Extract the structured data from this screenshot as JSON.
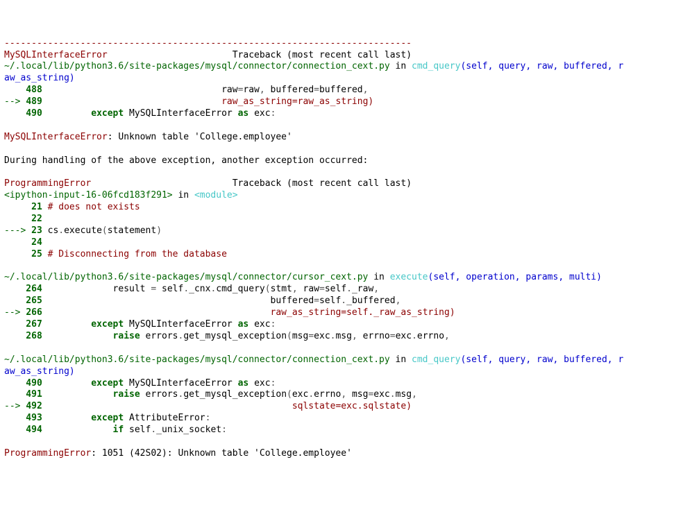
{
  "separator": "---------------------------------------------------------------------------",
  "tb1": {
    "error_name": "MySQLInterfaceError",
    "padding1": "                       ",
    "traceback_text": "Traceback (most recent call last)",
    "path": "~/.local/lib/python3.6/site-packages/mysql/connector/connection_cext.py",
    "in": " in ",
    "func": "cmd_query",
    "sig_open": "(self, query, raw, buffered, r",
    "sig_wrap": "aw_as_string)",
    "lines": {
      "l488_num": "    488 ",
      "l488_code": "                                raw",
      "l488_eq1": "=",
      "l488_code2": "raw",
      "l488_comma": ", ",
      "l488_code3": "buffered",
      "l488_eq2": "=",
      "l488_code4": "buffered",
      "l488_comma2": ",",
      "l489_arrow": "--> ",
      "l489_num": "489 ",
      "l489_sp": "                                ",
      "l489_code": "raw_as_string",
      "l489_eq": "=",
      "l489_code2": "raw_as_string",
      "l489_paren": ")",
      "l490_num": "    490 ",
      "l490_sp": "        ",
      "l490_kw1": "except",
      "l490_sp2": " ",
      "l490_code": "MySQLInterfaceError ",
      "l490_kw2": "as",
      "l490_sp3": " ",
      "l490_code2": "exc",
      "l490_colon": ":"
    },
    "msg_label": "MySQLInterfaceError",
    "msg_text": ": Unknown table 'College.employee'"
  },
  "during": "During handling of the above exception, another exception occurred:",
  "tb2": {
    "error_name": "ProgrammingError",
    "padding1": "                          ",
    "traceback_text": "Traceback (most recent call last)",
    "ipy_src": "<ipython-input-16-06fcd183f291>",
    "in": " in ",
    "module": "<module>",
    "f1": {
      "l21_num": "     21 ",
      "l21_comment": "# does not exists",
      "l22_num": "     22 ",
      "l23_arrow": "---> ",
      "l23_num": "23 ",
      "l23_c1": "cs",
      "l23_dot": ".",
      "l23_c2": "execute",
      "l23_p1": "(",
      "l23_c3": "statement",
      "l23_p2": ")",
      "l24_num": "     24 ",
      "l25_num": "     25 ",
      "l25_comment": "# Disconnecting from the database"
    },
    "f2": {
      "path": "~/.local/lib/python3.6/site-packages/mysql/connector/cursor_cext.py",
      "in": " in ",
      "func": "execute",
      "sig": "(self, operation, params, multi)",
      "l264_num": "    264 ",
      "l264_c": "            result ",
      "l264_eq": "=",
      "l264_c2": " self",
      "l264_dot": ".",
      "l264_c3": "_cnx",
      "l264_dot2": ".",
      "l264_c4": "cmd_query",
      "l264_p1": "(",
      "l264_c5": "stmt",
      "l264_cm1": ", ",
      "l264_c6": "raw",
      "l264_eq2": "=",
      "l264_c7": "self",
      "l264_dot3": ".",
      "l264_c8": "_raw",
      "l264_cm2": ",",
      "l265_num": "    265 ",
      "l265_sp": "                                         ",
      "l265_c1": "buffered",
      "l265_eq": "=",
      "l265_c2": "self",
      "l265_dot": ".",
      "l265_c3": "_buffered",
      "l265_cm": ",",
      "l266_arrow": "--> ",
      "l266_num": "266 ",
      "l266_sp": "                                         ",
      "l266_c1": "raw_as_string",
      "l266_eq": "=",
      "l266_c2": "self",
      "l266_dot": ".",
      "l266_c3": "_raw_as_string",
      "l266_p": ")",
      "l267_num": "    267 ",
      "l267_sp": "        ",
      "l267_kw1": "except",
      "l267_c1": " MySQLInterfaceError ",
      "l267_kw2": "as",
      "l267_c2": " exc",
      "l267_col": ":",
      "l268_num": "    268 ",
      "l268_sp": "            ",
      "l268_kw": "raise",
      "l268_c1": " errors",
      "l268_dot": ".",
      "l268_c2": "get_mysql_exception",
      "l268_p1": "(",
      "l268_c3": "msg",
      "l268_eq1": "=",
      "l268_c4": "exc",
      "l268_dot2": ".",
      "l268_c5": "msg",
      "l268_cm": ", ",
      "l268_c6": "errno",
      "l268_eq2": "=",
      "l268_c7": "exc",
      "l268_dot3": ".",
      "l268_c8": "errno",
      "l268_cm2": ","
    },
    "f3": {
      "path": "~/.local/lib/python3.6/site-packages/mysql/connector/connection_cext.py",
      "in": " in ",
      "func": "cmd_query",
      "sig_open": "(self, query, raw, buffered, r",
      "sig_wrap": "aw_as_string)",
      "l490_num": "    490 ",
      "l490_sp": "        ",
      "l490_kw1": "except",
      "l490_c1": " MySQLInterfaceError ",
      "l490_kw2": "as",
      "l490_c2": " exc",
      "l490_col": ":",
      "l491_num": "    491 ",
      "l491_sp": "            ",
      "l491_kw": "raise",
      "l491_c1": " errors",
      "l491_dot1": ".",
      "l491_c2": "get_mysql_exception",
      "l491_p1": "(",
      "l491_c3": "exc",
      "l491_dot2": ".",
      "l491_c4": "errno",
      "l491_cm": ", ",
      "l491_c5": "msg",
      "l491_eq": "=",
      "l491_c6": "exc",
      "l491_dot3": ".",
      "l491_c7": "msg",
      "l491_cm2": ",",
      "l492_arrow": "--> ",
      "l492_num": "492 ",
      "l492_sp": "                                             ",
      "l492_c1": "sqlstate",
      "l492_eq": "=",
      "l492_c2": "exc",
      "l492_dot": ".",
      "l492_c3": "sqlstate",
      "l492_p": ")",
      "l493_num": "    493 ",
      "l493_sp": "        ",
      "l493_kw1": "except",
      "l493_c1": " AttributeError",
      "l493_col": ":",
      "l494_num": "    494 ",
      "l494_sp": "            ",
      "l494_kw": "if",
      "l494_c1": " self",
      "l494_dot": ".",
      "l494_c2": "_unix_socket",
      "l494_col": ":"
    },
    "msg_label": "ProgrammingError",
    "msg_text": ": 1051 (42S02): Unknown table 'College.employee'"
  }
}
